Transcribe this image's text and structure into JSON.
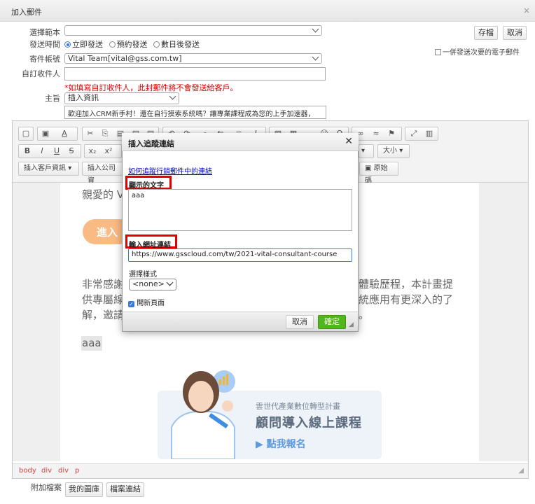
{
  "window": {
    "title": "加入郵件",
    "close": "×"
  },
  "form": {
    "template_label": "選擇範本",
    "template_value": "",
    "send_time_label": "發送時間",
    "send_time_options": [
      "立即發送",
      "預約發送",
      "數日後發送"
    ],
    "account_label": "寄件帳號",
    "account_value": "Vital Team[vital@gss.com.tw]",
    "custom_recipient_label": "自訂收件人",
    "custom_recipient_value": "",
    "warning": "*如填寫自訂收件人，此封郵件將不會發送給客戶。",
    "subject_label": "主旨",
    "subject_insert": "插入資訊",
    "subject_value": "歡迎加入CRM新手村！還在自行摸索系統嗎？讓專業課程成為您的上手加速器，"
  },
  "actions": {
    "save": "存檔",
    "cancel": "取消",
    "send_next": "一併發送次要的電子郵件"
  },
  "toolbar": {
    "size_label": "大小",
    "insert_customer": "插入客戶資訊",
    "insert_company": "插入公司資",
    "source": "原始碼"
  },
  "editor": {
    "greeting": "親愛的 V",
    "button_partial": "進入",
    "para_left_1": "非常感謝",
    "para_left_2": "供專屬線",
    "para_left_3": "解，邀請",
    "para_right_1": "體驗歷程，本計畫提",
    "para_right_2": "統應用有更深入的了",
    "para_right_3": "。",
    "selected_text": "aaa",
    "banner_small": "雲世代產業數位轉型計畫",
    "banner_title": "顧問導入線上課程",
    "banner_cta": "點我報名",
    "path": [
      "body",
      "div",
      "div",
      "p"
    ]
  },
  "dialog": {
    "title": "插入追蹤連結",
    "help_link": "如何追蹤行銷郵件中的連結",
    "display_text_label": "顯示的文字",
    "display_text_value": "aaa",
    "url_label": "輸入網址連結",
    "url_value": "https://www.gsscloud.com/tw/2021-vital-consultant-course",
    "style_label": "選擇樣式",
    "style_value": "<none>",
    "new_page_label": "開新頁面",
    "new_page_checked": true,
    "cancel": "取消",
    "ok": "確定"
  },
  "attachments": {
    "label": "附加檔案",
    "my_library": "我的圖庫",
    "file_link": "檔案連結"
  },
  "colors": {
    "accent_green": "#52b520",
    "warning_red": "#e00000",
    "link_blue": "#0000cc",
    "orange": "#f7a35c"
  }
}
